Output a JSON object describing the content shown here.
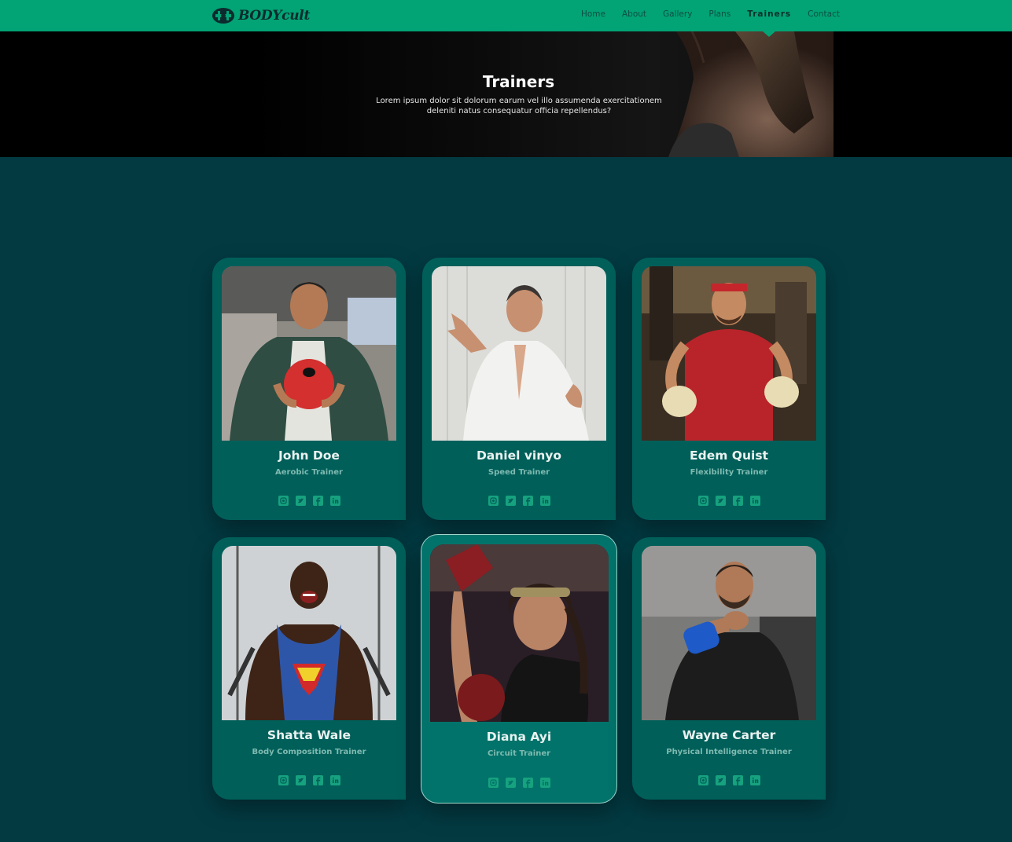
{
  "brand": {
    "name": "BODYcult",
    "color": "#02a374"
  },
  "nav": {
    "items": [
      "Home",
      "About",
      "Gallery",
      "Plans",
      "Trainers",
      "Contact"
    ],
    "active": "Trainers"
  },
  "hero": {
    "title": "Trainers",
    "subtitle_line1": "Lorem ipsum dolor sit dolorum earum vel illo assumenda exercitationem",
    "subtitle_line2": "deleniti natus consequatur officia repellendus?"
  },
  "trainers": [
    {
      "name": "John Doe",
      "role": "Aerobic Trainer"
    },
    {
      "name": "Daniel vinyo",
      "role": "Speed Trainer"
    },
    {
      "name": "Edem Quist",
      "role": "Flexibility Trainer"
    },
    {
      "name": "Shatta Wale",
      "role": "Body Composition Trainer"
    },
    {
      "name": "Diana Ayi",
      "role": "Circuit Trainer"
    },
    {
      "name": "Wayne Carter",
      "role": "Physical Intelligence Trainer"
    }
  ],
  "social_icons": [
    "instagram-icon",
    "twitter-icon",
    "facebook-icon",
    "linkedin-icon"
  ],
  "colors": {
    "background": "#033a42",
    "card": "#015f5a",
    "card_highlight": "#02736a",
    "icon": "#16a27e"
  }
}
